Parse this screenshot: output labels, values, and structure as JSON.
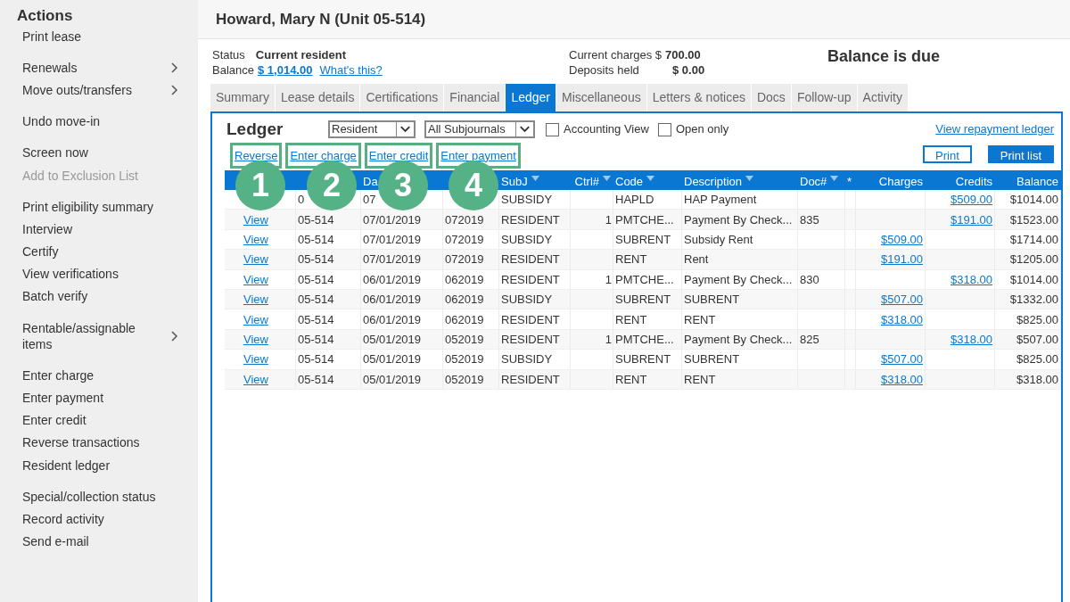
{
  "sidebar": {
    "title": "Actions",
    "groups": [
      {
        "items": [
          {
            "label": "Print lease",
            "disabled": false,
            "submenu": false
          }
        ]
      },
      {
        "items": [
          {
            "label": "Renewals",
            "disabled": false,
            "submenu": true
          },
          {
            "label": "Move outs/transfers",
            "disabled": false,
            "submenu": true
          }
        ]
      },
      {
        "items": [
          {
            "label": "Undo move-in",
            "disabled": false,
            "submenu": false
          }
        ]
      },
      {
        "items": [
          {
            "label": "Screen now",
            "disabled": false,
            "submenu": false
          },
          {
            "label": "Add to Exclusion List",
            "disabled": true,
            "submenu": false
          }
        ]
      },
      {
        "items": [
          {
            "label": "Print eligibility summary",
            "disabled": false,
            "submenu": false
          },
          {
            "label": "Interview",
            "disabled": false,
            "submenu": false
          },
          {
            "label": "Certify",
            "disabled": false,
            "submenu": false
          },
          {
            "label": "View verifications",
            "disabled": false,
            "submenu": false
          },
          {
            "label": "Batch verify",
            "disabled": false,
            "submenu": false
          }
        ]
      },
      {
        "items": [
          {
            "label": "Rentable/assignable items",
            "disabled": false,
            "submenu": true
          }
        ]
      },
      {
        "items": [
          {
            "label": "Enter charge",
            "disabled": false,
            "submenu": false
          },
          {
            "label": "Enter payment",
            "disabled": false,
            "submenu": false
          },
          {
            "label": "Enter credit",
            "disabled": false,
            "submenu": false
          },
          {
            "label": "Reverse transactions",
            "disabled": false,
            "submenu": false
          },
          {
            "label": "Resident ledger",
            "disabled": false,
            "submenu": false
          }
        ]
      },
      {
        "items": [
          {
            "label": "Special/collection status",
            "disabled": false,
            "submenu": false
          },
          {
            "label": "Record activity",
            "disabled": false,
            "submenu": false
          },
          {
            "label": "Send e-mail",
            "disabled": false,
            "submenu": false
          }
        ]
      }
    ]
  },
  "header": {
    "title": "Howard, Mary N (Unit 05-514)"
  },
  "summary": {
    "status_label": "Status",
    "status": "Current resident",
    "balance_label": "Balance",
    "balance": "$ 1,014.00",
    "help_link": "What's this?",
    "charges_label": "Current charges $",
    "charges": "700.00",
    "deposits_label": "Deposits held",
    "deposits": "$ 0.00",
    "alert": "Balance is due"
  },
  "tabs": [
    {
      "label": "Summary",
      "selected": false
    },
    {
      "label": "Lease details",
      "selected": false
    },
    {
      "label": "Certifications",
      "selected": false
    },
    {
      "label": "Financial",
      "selected": false
    },
    {
      "label": "Ledger",
      "selected": true
    },
    {
      "label": "Miscellaneous",
      "selected": false
    },
    {
      "label": "Letters & notices",
      "selected": false
    },
    {
      "label": "Docs",
      "selected": false
    },
    {
      "label": "Follow-up",
      "selected": false
    },
    {
      "label": "Activity",
      "selected": false
    }
  ],
  "ledger": {
    "title": "Ledger",
    "filters": [
      {
        "value": "Resident"
      },
      {
        "value": "All Subjournals"
      }
    ],
    "checkboxes": [
      {
        "label": "Accounting View",
        "checked": false
      },
      {
        "label": "Open only",
        "checked": false
      }
    ],
    "repayment_link": "View repayment ledger",
    "actions": [
      {
        "label": "Reverse",
        "badge": "1"
      },
      {
        "label": "Enter charge",
        "badge": "2"
      },
      {
        "label": "Enter credit",
        "badge": "3"
      },
      {
        "label": "Enter payment",
        "badge": "4"
      }
    ],
    "buttons": [
      {
        "label": "Print",
        "primary": false
      },
      {
        "label": "Print list",
        "primary": true
      }
    ],
    "table": {
      "columns": [
        {},
        {},
        {
          "label": "Da"
        },
        {},
        {
          "label": "SubJ",
          "sort": true
        },
        {
          "label": "Ctrl#",
          "sort": true
        },
        {
          "label": "Code",
          "sort": true
        },
        {
          "label": "Description",
          "sort": true
        },
        {
          "label": "Doc#",
          "sort": true
        },
        {
          "label": "*"
        },
        {
          "label": "Charges"
        },
        {
          "label": "Credits"
        },
        {
          "label": "Balance"
        }
      ],
      "rows": [
        [
          "",
          "0",
          "07",
          "",
          "SUBSIDY",
          "",
          "HAPLD",
          "HAP Payment",
          "",
          "",
          "",
          "$509.00",
          "$1014.00"
        ],
        [
          "View",
          "05-514",
          "07/01/2019",
          "072019",
          "RESIDENT",
          "1",
          "PMTCHE...",
          "Payment By Check...",
          "835",
          "",
          "",
          "$191.00",
          "$1523.00"
        ],
        [
          "View",
          "05-514",
          "07/01/2019",
          "072019",
          "SUBSIDY",
          "",
          "SUBRENT",
          "Subsidy Rent",
          "",
          "",
          "$509.00",
          "",
          "$1714.00"
        ],
        [
          "View",
          "05-514",
          "07/01/2019",
          "072019",
          "RESIDENT",
          "",
          "RENT",
          "Rent",
          "",
          "",
          "$191.00",
          "",
          "$1205.00"
        ],
        [
          "View",
          "05-514",
          "06/01/2019",
          "062019",
          "RESIDENT",
          "1",
          "PMTCHE...",
          "Payment By Check...",
          "830",
          "",
          "",
          "$318.00",
          "$1014.00"
        ],
        [
          "View",
          "05-514",
          "06/01/2019",
          "062019",
          "SUBSIDY",
          "",
          "SUBRENT",
          "SUBRENT",
          "",
          "",
          "$507.00",
          "",
          "$1332.00"
        ],
        [
          "View",
          "05-514",
          "06/01/2019",
          "062019",
          "RESIDENT",
          "",
          "RENT",
          "RENT",
          "",
          "",
          "$318.00",
          "",
          "$825.00"
        ],
        [
          "View",
          "05-514",
          "05/01/2019",
          "052019",
          "RESIDENT",
          "1",
          "PMTCHE...",
          "Payment By Check...",
          "825",
          "",
          "",
          "$318.00",
          "$507.00"
        ],
        [
          "View",
          "05-514",
          "05/01/2019",
          "052019",
          "SUBSIDY",
          "",
          "SUBRENT",
          "SUBRENT",
          "",
          "",
          "$507.00",
          "",
          "$825.00"
        ],
        [
          "View",
          "05-514",
          "05/01/2019",
          "052019",
          "RESIDENT",
          "",
          "RENT",
          "RENT",
          "",
          "",
          "$318.00",
          "",
          "$318.00"
        ]
      ]
    }
  }
}
